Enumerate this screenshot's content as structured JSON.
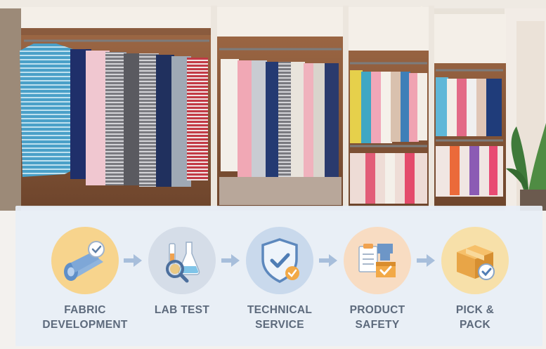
{
  "scene": {
    "description_icon": "wardrobe-photo",
    "panel_bg": "#e8eef6"
  },
  "steps": [
    {
      "label": "FABRIC\nDEVELOPMENT",
      "icon": "fabric-roll-icon",
      "color": "#f7d48d"
    },
    {
      "label": "LAB TEST",
      "icon": "lab-flask-icon",
      "color": "#d5dde8"
    },
    {
      "label": "TECHNICAL\nSERVICE",
      "icon": "shield-check-icon",
      "color": "#c9d9ec"
    },
    {
      "label": "PRODUCT\nSAFETY",
      "icon": "clipboard-box-icon",
      "color": "#f8dcc2"
    },
    {
      "label": "PICK &\nPACK",
      "icon": "package-box-icon",
      "color": "#f7e0a9"
    }
  ],
  "colors": {
    "label": "#5d6a7c",
    "arrow": "#9fb8d8",
    "accent_orange": "#e9a54a",
    "accent_blue": "#6d96c7"
  }
}
